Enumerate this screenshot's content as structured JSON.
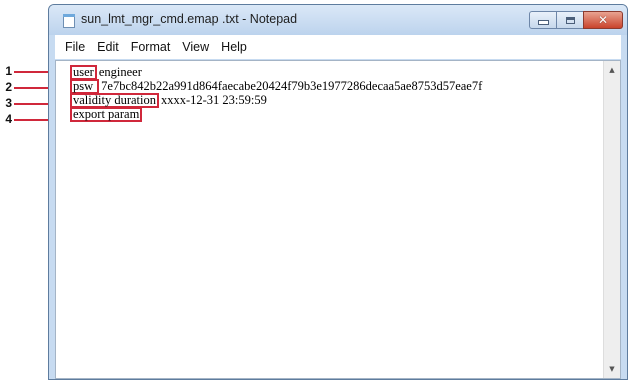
{
  "window": {
    "title": "sun_lmt_mgr_cmd.emap .txt - Notepad",
    "close_glyph": "✕"
  },
  "menu": {
    "items": [
      "File",
      "Edit",
      "Format",
      "View",
      "Help"
    ]
  },
  "content": {
    "lines": [
      {
        "key": "user",
        "value": "engineer"
      },
      {
        "key": "psw",
        "value": "7e7bc842b22a991d864faecabe20424f79b3e1977286decaa5ae8753d57eae7f"
      },
      {
        "key": "validity duration",
        "value": "xxxx-12-31 23:59:59"
      },
      {
        "key": "export param",
        "value": ""
      }
    ]
  },
  "callouts": [
    "1",
    "2",
    "3",
    "4"
  ],
  "colors": {
    "highlight": "#d0283b"
  },
  "scroll": {
    "up_glyph": "▲",
    "down_glyph": "▼"
  }
}
